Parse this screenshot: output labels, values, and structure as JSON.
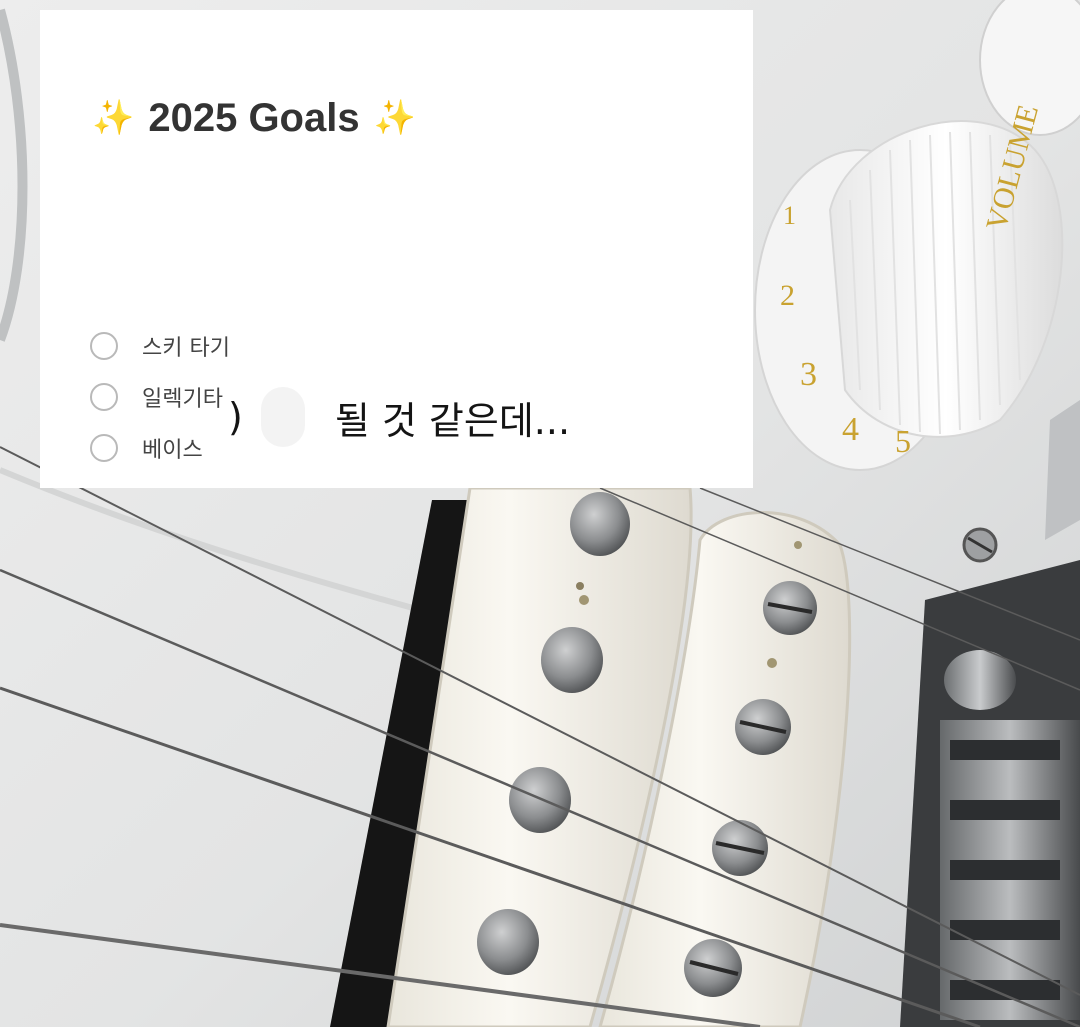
{
  "goals_card": {
    "sparkle_left": "✨",
    "title": "2025 Goals",
    "sparkle_right": "✨",
    "items": [
      {
        "label": "스키 타기",
        "checked": false
      },
      {
        "label": "일렉기타",
        "checked": false
      },
      {
        "label": "베이스",
        "checked": false
      },
      {
        "label": "",
        "checked": false
      }
    ]
  },
  "caption": {
    "paren": ")",
    "text": "될 것 같은데..."
  },
  "knob": {
    "label": "VOLUME",
    "numbers": [
      "1",
      "2",
      "3",
      "4",
      "5"
    ]
  },
  "colors": {
    "pickguard": "#f2f2f1",
    "pickup_cover": "#f4f1e6",
    "pole_piece": "#8f9193",
    "string": "#5b5b5b",
    "knob_gold": "#c9a230"
  }
}
